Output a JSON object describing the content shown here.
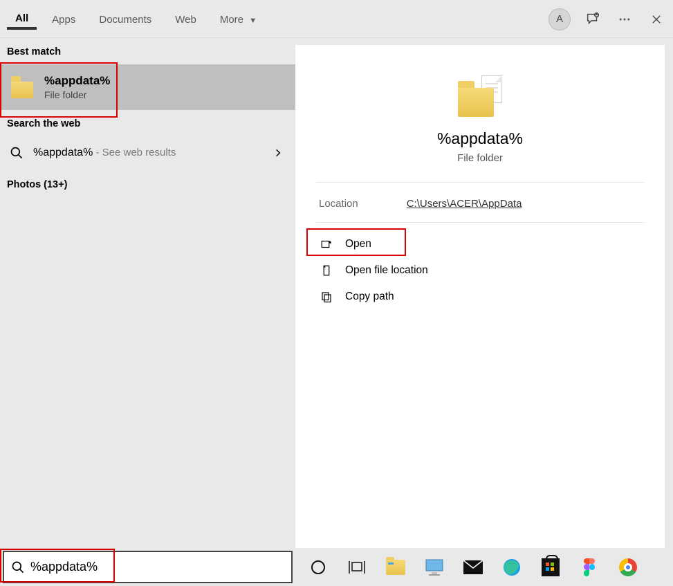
{
  "tabs": {
    "all": "All",
    "apps": "Apps",
    "documents": "Documents",
    "web": "Web",
    "more": "More"
  },
  "avatar_letter": "A",
  "left": {
    "best_match_heading": "Best match",
    "best_match_title": "%appdata%",
    "best_match_subtitle": "File folder",
    "search_web_heading": "Search the web",
    "web_term": "%appdata%",
    "web_hint": " - See web results",
    "photos_heading": "Photos (13+)"
  },
  "right": {
    "title": "%appdata%",
    "subtitle": "File folder",
    "location_label": "Location",
    "location_value": "C:\\Users\\ACER\\AppData",
    "actions": {
      "open": "Open",
      "open_loc": "Open file location",
      "copy_path": "Copy path"
    }
  },
  "search_value": "%appdata%"
}
